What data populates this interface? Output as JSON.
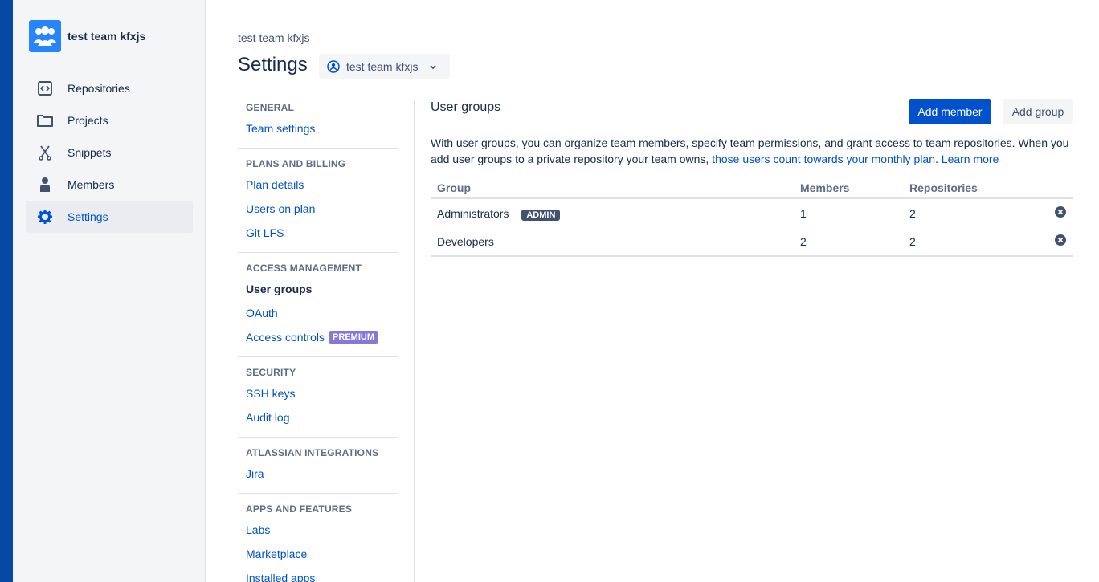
{
  "colors": {
    "brand": "#0052cc",
    "rail": "#0747a6",
    "premium": "#8777d9",
    "admin_badge": "#42526e"
  },
  "sidebar": {
    "team_name": "test team kfxjs",
    "items": [
      {
        "label": "Repositories",
        "icon": "repository-icon"
      },
      {
        "label": "Projects",
        "icon": "folder-icon"
      },
      {
        "label": "Snippets",
        "icon": "scissors-icon"
      },
      {
        "label": "Members",
        "icon": "person-icon"
      },
      {
        "label": "Settings",
        "icon": "gear-icon",
        "active": true
      }
    ]
  },
  "header": {
    "breadcrumb": "test team kfxjs",
    "title": "Settings",
    "team_selector": "test team kfxjs"
  },
  "subnav": {
    "sections": [
      {
        "heading": "GENERAL",
        "links": [
          "Team settings"
        ]
      },
      {
        "heading": "PLANS AND BILLING",
        "links": [
          "Plan details",
          "Users on plan",
          "Git LFS"
        ]
      },
      {
        "heading": "ACCESS MANAGEMENT",
        "links": [
          "User groups",
          "OAuth",
          "Access controls"
        ],
        "premium_badge": "PREMIUM"
      },
      {
        "heading": "SECURITY",
        "links": [
          "SSH keys",
          "Audit log"
        ]
      },
      {
        "heading": "ATLASSIAN INTEGRATIONS",
        "links": [
          "Jira"
        ]
      },
      {
        "heading": "APPS AND FEATURES",
        "links": [
          "Labs",
          "Marketplace",
          "Installed apps"
        ]
      }
    ],
    "current": "User groups"
  },
  "content": {
    "title": "User groups",
    "add_member": "Add member",
    "add_group": "Add group",
    "description_prefix": "With user groups, you can organize team members, specify team permissions, and grant access to team repositories. When you add user groups to a private repository your team owns, ",
    "description_link": "those users count towards your monthly plan",
    "description_suffix": ". ",
    "learn_more": "Learn more",
    "table": {
      "headers": [
        "Group",
        "Members",
        "Repositories"
      ],
      "rows": [
        {
          "group": "Administrators",
          "badge": "ADMIN",
          "members": "1",
          "repositories": "2"
        },
        {
          "group": "Developers",
          "badge": "",
          "members": "2",
          "repositories": "2"
        }
      ]
    }
  }
}
